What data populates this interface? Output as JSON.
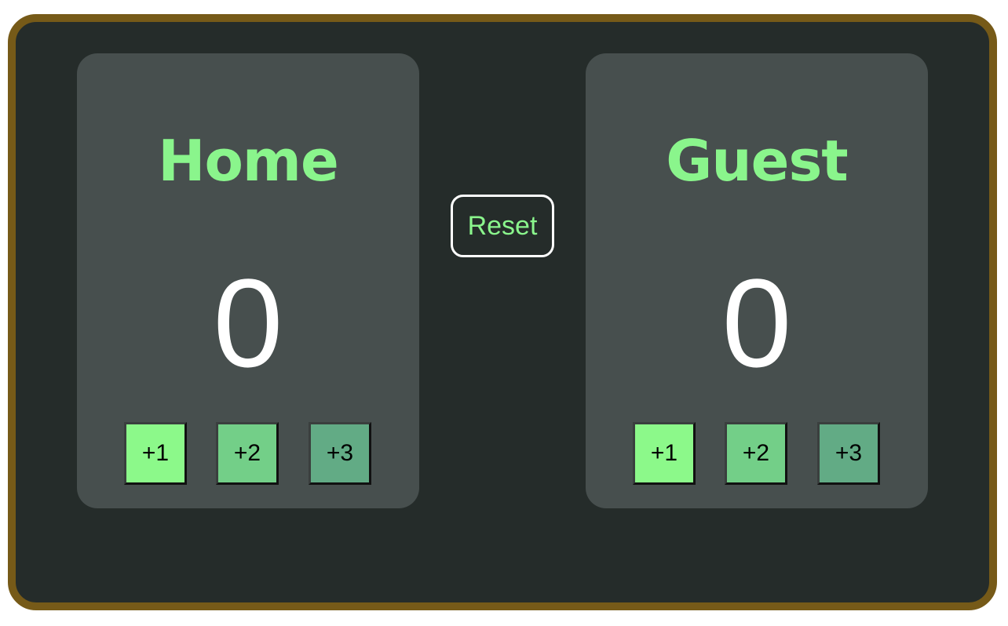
{
  "colors": {
    "frame": "#765a18",
    "board_background": "#252c2a",
    "panel_background": "#474f4e",
    "team_name": "#8af58c",
    "score": "#ffffff",
    "button_plus1": "#8cf98a",
    "button_plus2": "#73cf88",
    "button_plus3": "#62ab85",
    "reset_text": "#8af58c",
    "reset_border": "#ffffff"
  },
  "home": {
    "name": "Home",
    "score": "0",
    "buttons": [
      "+1",
      "+2",
      "+3"
    ]
  },
  "guest": {
    "name": "Guest",
    "score": "0",
    "buttons": [
      "+1",
      "+2",
      "+3"
    ]
  },
  "controls": {
    "reset_label": "Reset"
  }
}
